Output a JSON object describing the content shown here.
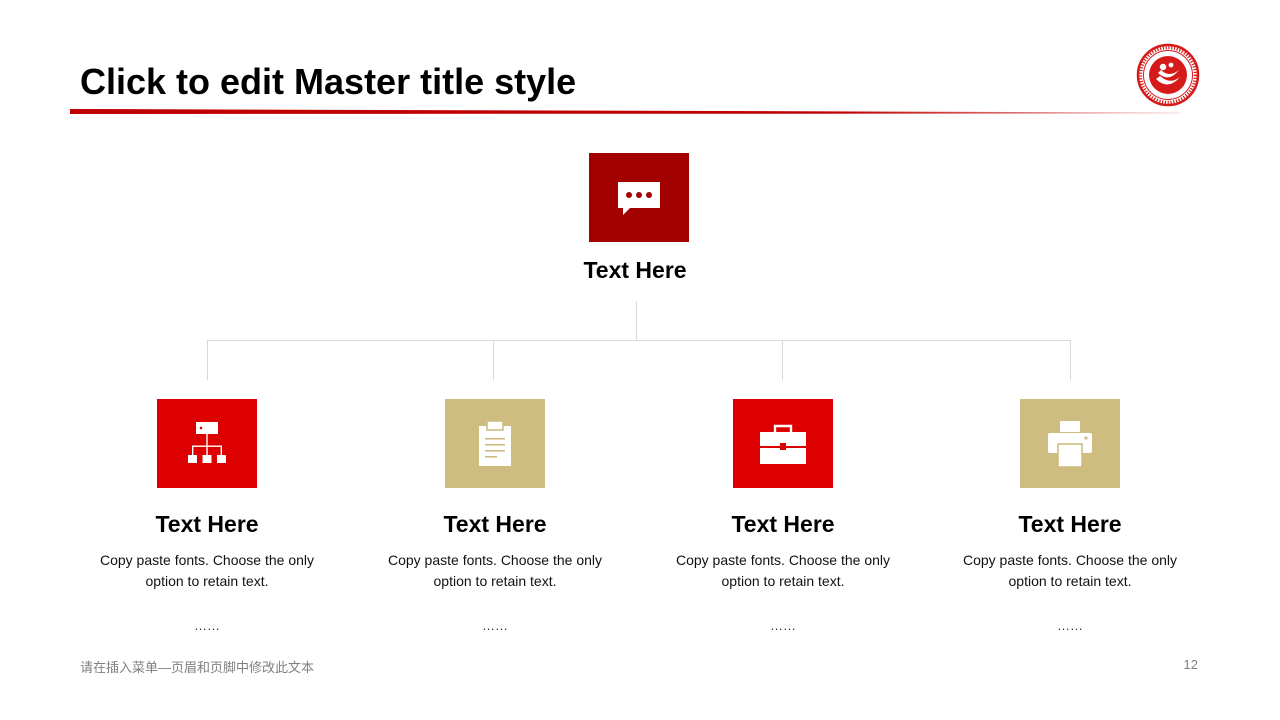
{
  "slide": {
    "title": "Click to edit Master title style",
    "footer": "请在插入菜单—页眉和页脚中修改此文本",
    "page_number": "12"
  },
  "colors": {
    "accent_dark_red": "#a30000",
    "accent_red": "#dc0000",
    "accent_gold": "#cfbc80",
    "rule_red": "#c00000"
  },
  "top": {
    "icon": "chat-bubble-icon",
    "label": "Text Here"
  },
  "items": [
    {
      "icon": "org-chart-icon",
      "label": "Text Here",
      "desc": "Copy paste fonts. Choose the only option to retain text.",
      "dots": "……"
    },
    {
      "icon": "clipboard-icon",
      "label": "Text Here",
      "desc": "Copy paste fonts. Choose the only option to retain text.",
      "dots": "……"
    },
    {
      "icon": "briefcase-icon",
      "label": "Text Here",
      "desc": "Copy paste fonts. Choose the only option to retain text.",
      "dots": "……"
    },
    {
      "icon": "printer-icon",
      "label": "Text Here",
      "desc": "Copy paste fonts. Choose the only option to retain text.",
      "dots": "……"
    }
  ]
}
